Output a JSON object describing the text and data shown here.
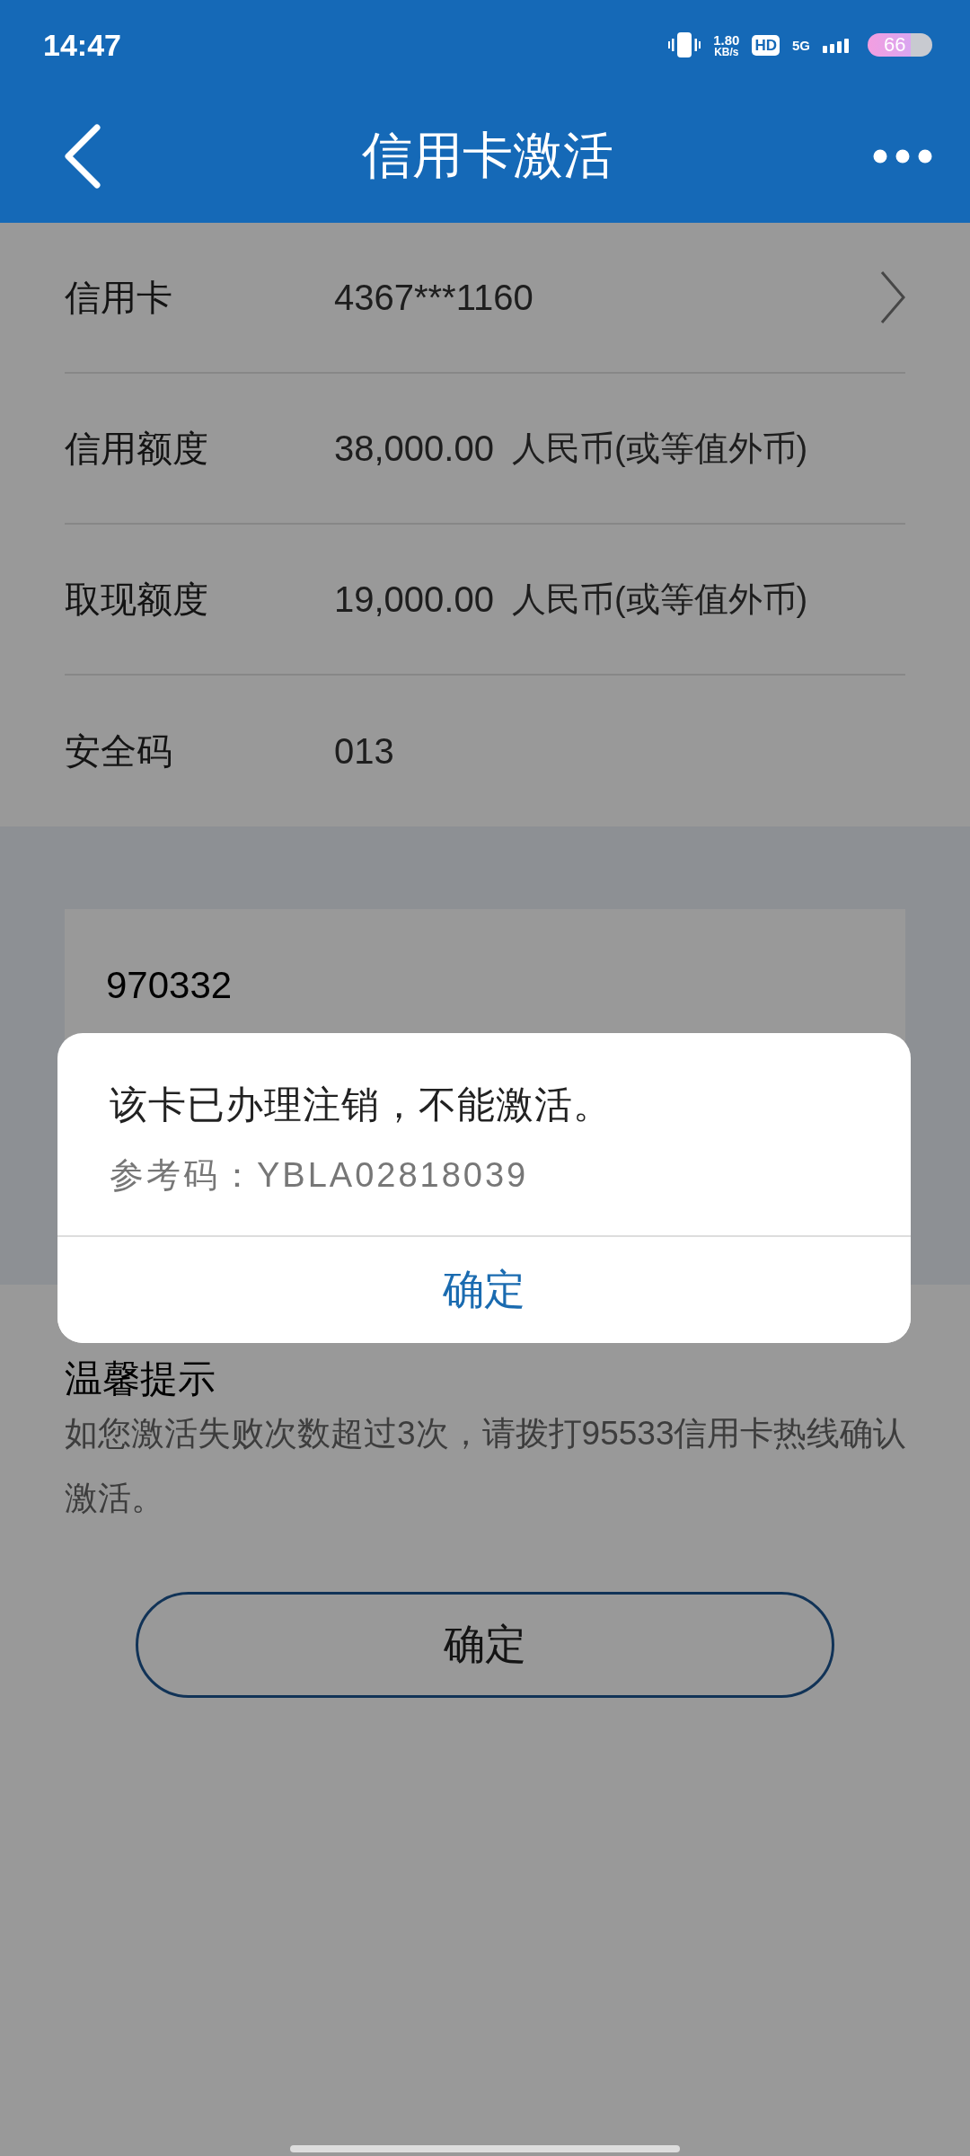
{
  "status_bar": {
    "time": "14:47",
    "speed_value": "1.80",
    "speed_unit": "KB/s",
    "hd": "HD",
    "network": "5G",
    "battery": "66"
  },
  "header": {
    "title": "信用卡激活"
  },
  "rows": [
    {
      "label": "信用卡",
      "value": "4367***1160",
      "arrow": true
    },
    {
      "label": "信用额度",
      "value": "38,000.00",
      "unit": "人民币(或等值外币)",
      "arrow": false
    },
    {
      "label": "取现额度",
      "value": "19,000.00",
      "unit": "人民币(或等值外币)",
      "arrow": false
    },
    {
      "label": "安全码",
      "value": "013",
      "arrow": false
    }
  ],
  "input": {
    "value": "970332"
  },
  "tips": {
    "title": "温馨提示",
    "text": "如您激活失败次数超过3次，请拨打95533信用卡热线确认激活。"
  },
  "confirm_button": "确定",
  "dialog": {
    "message": "该卡已办理注销，不能激活。",
    "reference": "参考码：YBLA02818039",
    "button": "确定"
  }
}
